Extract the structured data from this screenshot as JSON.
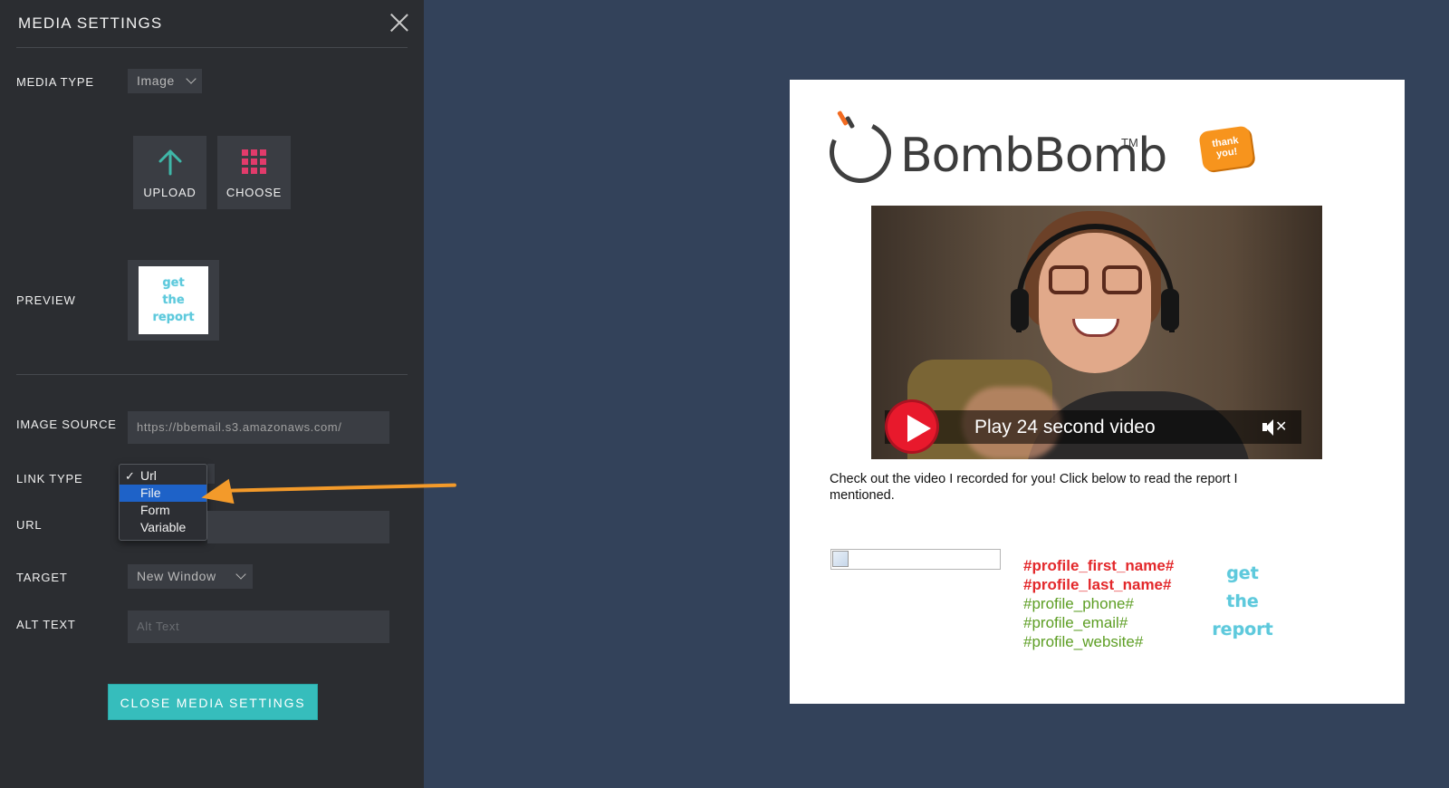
{
  "panel": {
    "title": "MEDIA SETTINGS",
    "media_type": {
      "label": "MEDIA TYPE",
      "value": "Image"
    },
    "upload_label": "UPLOAD",
    "choose_label": "CHOOSE",
    "preview": {
      "label": "PREVIEW",
      "words": [
        "get",
        "the",
        "report"
      ]
    },
    "image_source": {
      "label": "IMAGE SOURCE",
      "value": "https://bbemail.s3.amazonaws.com/"
    },
    "link_type": {
      "label": "LINK TYPE",
      "options": [
        "Url",
        "File",
        "Form",
        "Variable"
      ],
      "checked": "Url",
      "highlighted": "File"
    },
    "url": {
      "label": "URL",
      "value": ""
    },
    "target": {
      "label": "TARGET",
      "value": "New Window"
    },
    "alt_text": {
      "label": "ALT TEXT",
      "placeholder": "Alt Text"
    },
    "close_button": "CLOSE MEDIA SETTINGS"
  },
  "email": {
    "logo_text": "BombBomb",
    "logo_tm": "TM",
    "badge": [
      "thank",
      "you!"
    ],
    "video": {
      "play_text": "Play 24 second video"
    },
    "body_text": "Check out the video I recorded for you! Click below to read the report I mentioned.",
    "signature": {
      "first_name": "#profile_first_name#",
      "last_name": "#profile_last_name#",
      "phone": "#profile_phone#",
      "email": "#profile_email#",
      "website": "#profile_website#"
    },
    "report_words": [
      "get",
      "the",
      "report"
    ]
  },
  "colors": {
    "panel_bg": "#2b2d31",
    "page_bg": "#33425a",
    "accent_teal": "#36bdbc",
    "arrow_orange": "#f39a2a",
    "dropdown_highlight": "#1e62c8",
    "signature_red": "#e3282b",
    "signature_green": "#5d9e24"
  }
}
